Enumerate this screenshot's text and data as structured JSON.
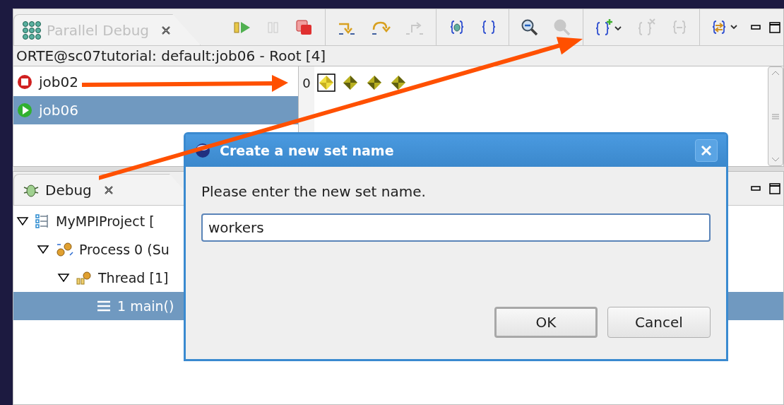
{
  "parallel_debug_view": {
    "tab_title": "Parallel Debug",
    "toolbar_groups": [
      [
        {
          "kind": "resume",
          "disabled": false
        },
        {
          "kind": "suspend",
          "disabled": true
        },
        {
          "kind": "terminate",
          "disabled": false
        }
      ],
      [
        {
          "kind": "step-into",
          "disabled": false
        },
        {
          "kind": "step-over",
          "disabled": false
        },
        {
          "kind": "step-return",
          "disabled": true
        }
      ],
      [
        {
          "kind": "register",
          "disabled": false
        },
        {
          "kind": "unregister",
          "disabled": false
        }
      ],
      [
        {
          "kind": "zoom-out",
          "disabled": false
        },
        {
          "kind": "zoom-in",
          "disabled": true
        }
      ],
      [
        {
          "kind": "create-set",
          "disabled": false
        },
        {
          "kind": "delete-set",
          "disabled": true
        },
        {
          "kind": "remove-from-set",
          "disabled": true
        }
      ],
      [
        {
          "kind": "change-set",
          "disabled": false
        }
      ]
    ],
    "breadcrumb": "ORTE@sc07tutorial: default:job06 - Root [4]",
    "jobs": [
      {
        "name": "job02",
        "kind": "terminated",
        "selected": false
      },
      {
        "name": "job06",
        "kind": "running",
        "selected": true
      }
    ],
    "process_row_label": "0",
    "processes": [
      {
        "selected": true
      },
      {
        "selected": false
      },
      {
        "selected": false
      },
      {
        "selected": false
      }
    ]
  },
  "debug_view": {
    "tab_title": "Debug",
    "tree": [
      {
        "label": "MyMPIProject [",
        "kind": "launch",
        "expanded": true,
        "selected": false,
        "children": [
          {
            "label": "Process 0 (Su",
            "kind": "process",
            "expanded": true,
            "selected": false,
            "children": [
              {
                "label": "Thread [1]",
                "kind": "thread",
                "expanded": true,
                "selected": false,
                "children": [
                  {
                    "label": "1 main()",
                    "kind": "frame",
                    "selected": true
                  }
                ]
              }
            ]
          }
        ]
      }
    ]
  },
  "dialog": {
    "title": "Create a new set name",
    "message": "Please enter the new set name.",
    "value": "workers",
    "buttons": [
      {
        "label": "OK",
        "default": true
      },
      {
        "label": "Cancel",
        "default": false
      }
    ]
  }
}
